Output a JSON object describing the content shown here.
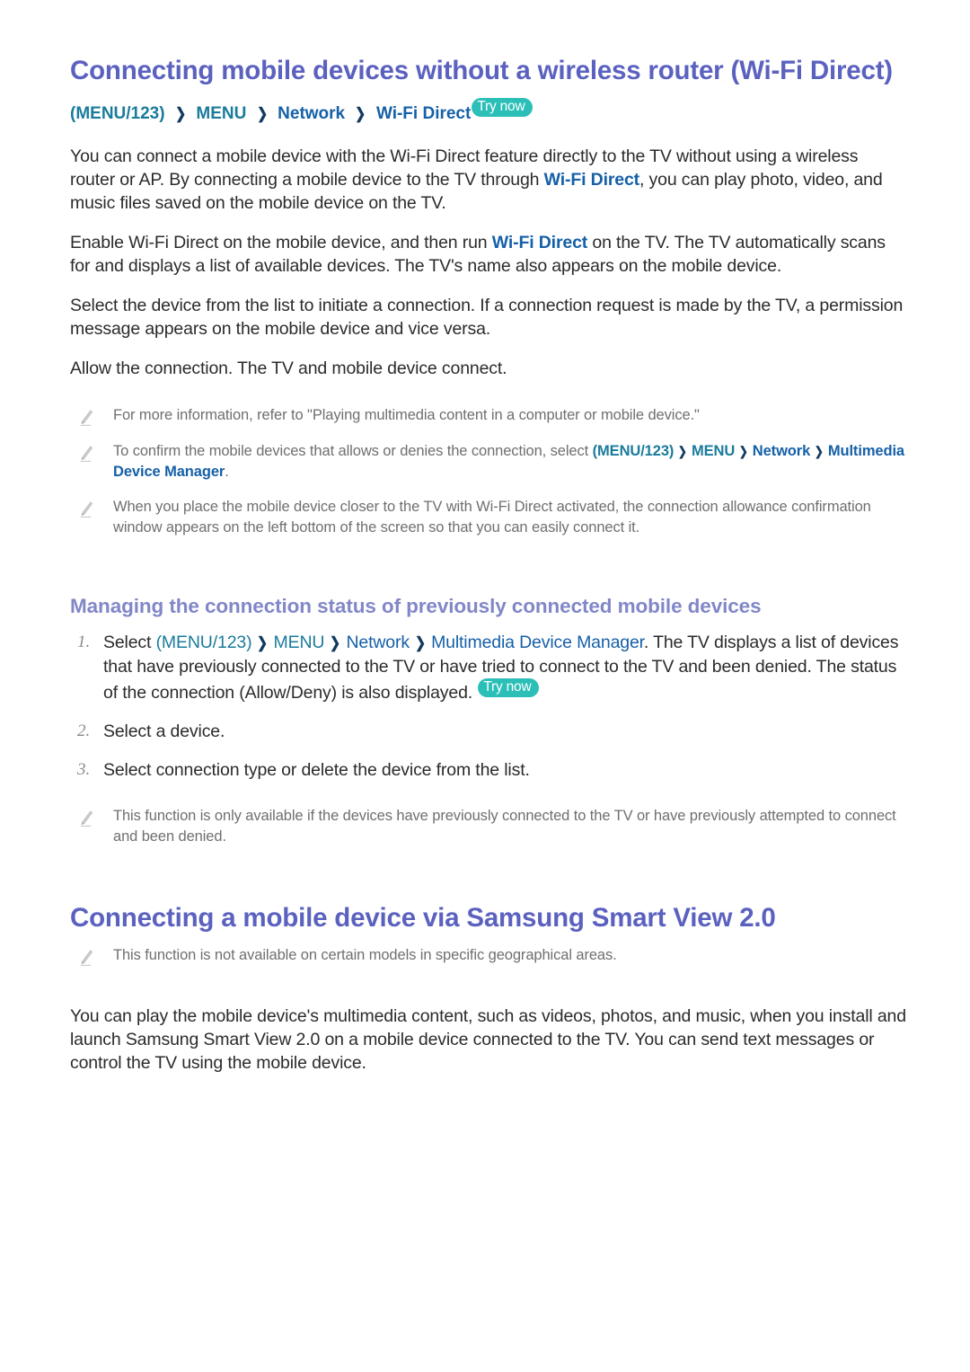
{
  "section1": {
    "heading": "Connecting mobile devices without a wireless router (Wi-Fi Direct)",
    "breadcrumb": {
      "menu123": "(MENU/123)",
      "menu": "MENU",
      "network": "Network",
      "leaf": "Wi-Fi Direct",
      "chevron": "❯",
      "try_now": "Try now"
    },
    "paragraphs": [
      {
        "part1": "You can connect a mobile device with the Wi-Fi Direct feature directly to the TV without using a wireless router or AP. By connecting a mobile device to the TV through ",
        "highlight": "Wi-Fi Direct",
        "part2": ", you can play photo, video, and music files saved on the mobile device on the TV."
      },
      {
        "part1": "Enable Wi-Fi Direct on the mobile device, and then run ",
        "highlight": "Wi-Fi Direct",
        "part2": " on the TV. The TV automatically scans for and displays a list of available devices. The TV's name also appears on the mobile device."
      },
      {
        "part1": "Select the device from the list to initiate a connection. If a connection request is made by the TV, a permission message appears on the mobile device and vice versa.",
        "highlight": "",
        "part2": ""
      },
      {
        "part1": "Allow the connection. The TV and mobile device connect.",
        "highlight": "",
        "part2": ""
      }
    ],
    "notes": [
      {
        "text": "For more information, refer to \"Playing multimedia content in a computer or mobile device.\""
      },
      {
        "prefix": "To confirm the mobile devices that allows or denies the connection, select ",
        "menu123": "(MENU/123)",
        "menu": "MENU",
        "network": "Network",
        "leaf": "Multimedia Device Manager",
        "suffix": "."
      },
      {
        "text": "When you place the mobile device closer to the TV with Wi-Fi Direct activated, the connection allowance confirmation window appears on the left bottom of the screen so that you can easily connect it."
      }
    ]
  },
  "section2": {
    "heading": "Managing the connection status of previously connected mobile devices",
    "steps": [
      {
        "marker": "1.",
        "prefix": "Select ",
        "menu123": "(MENU/123)",
        "menu": "MENU",
        "network": "Network",
        "leaf": "Multimedia Device Manager",
        "suffix": ". The TV displays a list of devices that have previously connected to the TV or have tried to connect to the TV and been denied. The status of the connection (Allow/Deny) is also displayed. ",
        "try_now": "Try now"
      },
      {
        "marker": "2.",
        "prefix": "Select a device.",
        "menu123": "",
        "menu": "",
        "network": "",
        "leaf": "",
        "suffix": "",
        "try_now": ""
      },
      {
        "marker": "3.",
        "prefix": "Select connection type or delete the device from the list.",
        "menu123": "",
        "menu": "",
        "network": "",
        "leaf": "",
        "suffix": "",
        "try_now": ""
      }
    ],
    "note": "This function is only available if the devices have previously connected to the TV or have previously attempted to connect and been denied."
  },
  "section3": {
    "heading": "Connecting a mobile device via Samsung Smart View 2.0",
    "note": "This function is not available on certain models in specific geographical areas.",
    "paragraph": "You can play the mobile device's multimedia content, such as videos, photos, and music, when you install and launch Samsung Smart View 2.0 on a mobile device connected to the TV. You can send text messages or control the TV using the mobile device."
  },
  "colors": {
    "heading_primary": "#5b61bf",
    "heading_secondary": "#8187c7",
    "link_teal": "#1a7b9b",
    "link_blue": "#1560a8",
    "badge_bg": "#2bbfb8",
    "body_text": "#2b2b2b",
    "note_text": "#6f6f6f"
  },
  "icons": {
    "note": "pencil-icon",
    "chevron": "chevron-right-icon"
  }
}
